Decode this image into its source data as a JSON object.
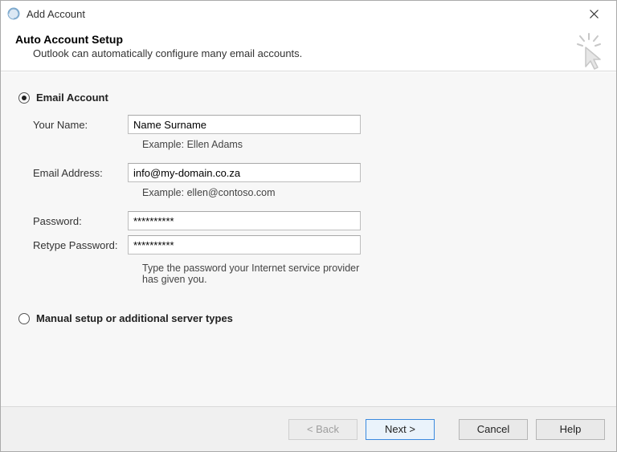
{
  "window": {
    "title": "Add Account"
  },
  "header": {
    "title": "Auto Account Setup",
    "subtitle": "Outlook can automatically configure many email accounts."
  },
  "options": {
    "email_account_label": "Email Account",
    "manual_label": "Manual setup or additional server types",
    "selected": "email_account"
  },
  "form": {
    "your_name_label": "Your Name:",
    "your_name_value": "Name Surname",
    "your_name_hint": "Example: Ellen Adams",
    "email_label": "Email Address:",
    "email_value": "info@my-domain.co.za",
    "email_hint": "Example: ellen@contoso.com",
    "password_label": "Password:",
    "password_value": "**********",
    "retype_label": "Retype Password:",
    "retype_value": "**********",
    "password_hint": "Type the password your Internet service provider has given you."
  },
  "buttons": {
    "back": "< Back",
    "next": "Next >",
    "cancel": "Cancel",
    "help": "Help"
  }
}
